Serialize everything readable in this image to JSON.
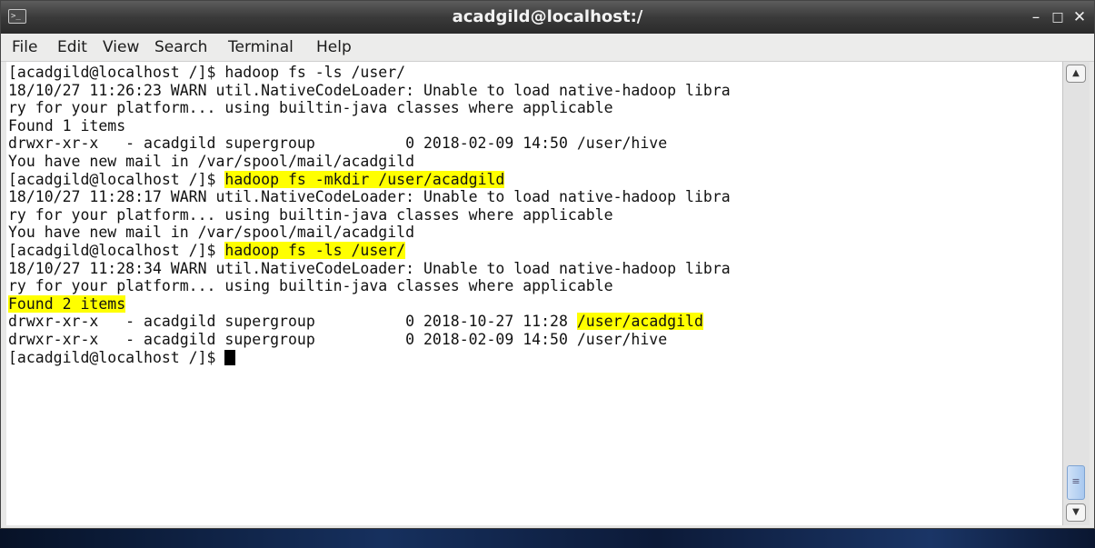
{
  "window": {
    "title": "acadgild@localhost:/",
    "terminal_icon_glyph": ">_",
    "controls": {
      "minimize": "–",
      "maximize": "□",
      "close": "✕"
    }
  },
  "menu": [
    "File",
    "Edit",
    "View",
    "Search",
    "Terminal",
    "Help"
  ],
  "colors": {
    "highlight": "#ffff00",
    "titlebar": "#3a3a3a",
    "terminal_bg": "#ffffff"
  },
  "terminal": {
    "lines": [
      [
        {
          "t": "[acadgild@localhost /]$ hadoop fs -ls /user/"
        }
      ],
      [
        {
          "t": "18/10/27 11:26:23 WARN util.NativeCodeLoader: Unable to load native-hadoop libra"
        }
      ],
      [
        {
          "t": "ry for your platform... using builtin-java classes where applicable"
        }
      ],
      [
        {
          "t": "Found 1 items"
        }
      ],
      [
        {
          "t": "drwxr-xr-x   - acadgild supergroup          0 2018-02-09 14:50 /user/hive"
        }
      ],
      [
        {
          "t": "You have new mail in /var/spool/mail/acadgild"
        }
      ],
      [
        {
          "t": "[acadgild@localhost /]$ "
        },
        {
          "t": "hadoop fs -mkdir /user/acadgild",
          "hl": true
        }
      ],
      [
        {
          "t": "18/10/27 11:28:17 WARN util.NativeCodeLoader: Unable to load native-hadoop libra"
        }
      ],
      [
        {
          "t": "ry for your platform... using builtin-java classes where applicable"
        }
      ],
      [
        {
          "t": "You have new mail in /var/spool/mail/acadgild"
        }
      ],
      [
        {
          "t": "[acadgild@localhost /]$ "
        },
        {
          "t": "hadoop fs -ls /user/",
          "hl": true
        }
      ],
      [
        {
          "t": "18/10/27 11:28:34 WARN util.NativeCodeLoader: Unable to load native-hadoop libra"
        }
      ],
      [
        {
          "t": "ry for your platform... using builtin-java classes where applicable"
        }
      ],
      [
        {
          "t": "Found 2 items",
          "hl": true
        }
      ],
      [
        {
          "t": "drwxr-xr-x   - acadgild supergroup          0 2018-10-27 11:28 "
        },
        {
          "t": "/user/acadgild",
          "hl": true
        }
      ],
      [
        {
          "t": "drwxr-xr-x   - acadgild supergroup          0 2018-02-09 14:50 /user/hive"
        }
      ],
      [
        {
          "t": "[acadgild@localhost /]$ "
        },
        {
          "cursor": true
        }
      ]
    ]
  }
}
